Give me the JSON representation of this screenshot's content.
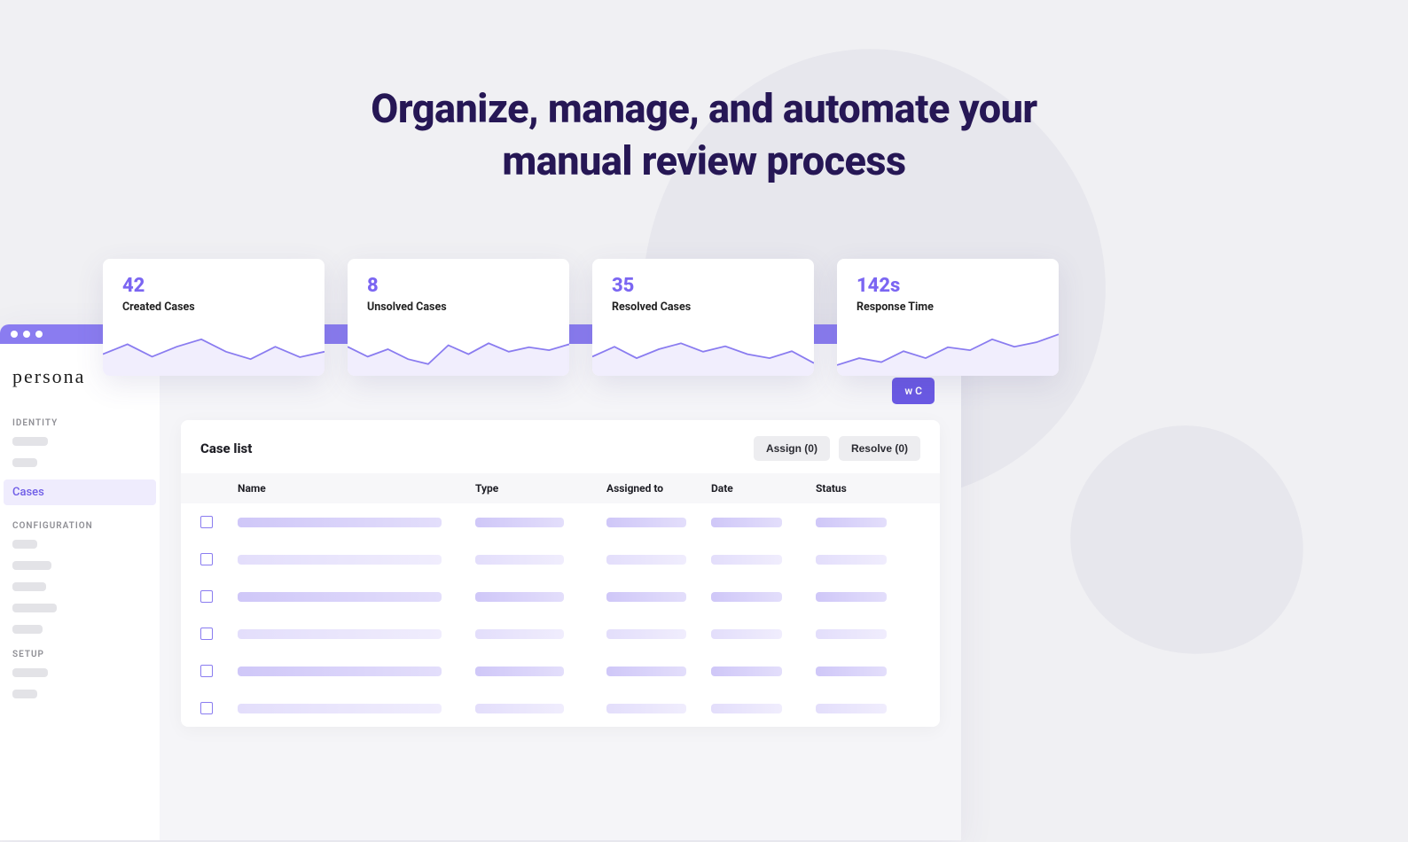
{
  "hero": {
    "headline_line1": "Organize, manage, and automate your",
    "headline_line2": "manual review process"
  },
  "logo_text": "persona",
  "sidebar": {
    "sections": {
      "identity_label": "IDENTITY",
      "configuration_label": "CONFIGURATION",
      "setup_label": "SETUP"
    },
    "active_item": "Cases"
  },
  "new_case_btn_partial": "w C",
  "stats": [
    {
      "value": "42",
      "label": "Created Cases"
    },
    {
      "value": "8",
      "label": "Unsolved Cases"
    },
    {
      "value": "35",
      "label": "Resolved Cases"
    },
    {
      "value": "142s",
      "label": "Response Time"
    }
  ],
  "case_list": {
    "title": "Case list",
    "actions": {
      "assign_label": "Assign (0)",
      "resolve_label": "Resolve (0)"
    },
    "columns": {
      "name": "Name",
      "type": "Type",
      "assigned_to": "Assigned to",
      "date": "Date",
      "status": "Status"
    },
    "row_count": 6
  },
  "colors": {
    "accent": "#7b66f2",
    "accent_light": "#efecfd",
    "stroke": "#8a7cf0",
    "heading": "#261755"
  },
  "chart_data": [
    {
      "type": "area",
      "title": "Created Cases",
      "ylim": [
        0,
        100
      ],
      "values": [
        40,
        60,
        35,
        55,
        70,
        45,
        30,
        55,
        34,
        45
      ]
    },
    {
      "type": "area",
      "title": "Unsolved Cases",
      "ylim": [
        0,
        100
      ],
      "values": [
        55,
        35,
        50,
        30,
        20,
        58,
        40,
        62,
        45,
        54,
        48,
        60
      ]
    },
    {
      "type": "area",
      "title": "Resolved Cases",
      "ylim": [
        0,
        100
      ],
      "values": [
        35,
        55,
        32,
        50,
        62,
        45,
        56,
        40,
        32,
        46,
        22
      ]
    },
    {
      "type": "area",
      "title": "Response Time",
      "ylim": [
        0,
        100
      ],
      "values": [
        18,
        32,
        24,
        46,
        32,
        54,
        48,
        70,
        55,
        64,
        80
      ]
    }
  ]
}
